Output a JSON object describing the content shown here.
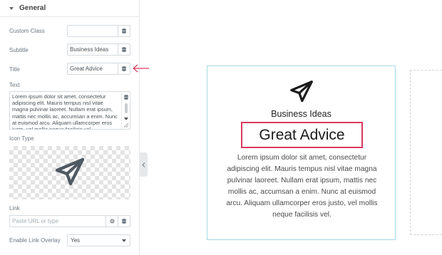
{
  "panel": {
    "section_title": "General",
    "fields": {
      "custom_class": {
        "label": "Custom Class",
        "value": ""
      },
      "subtitle": {
        "label": "Subtitle",
        "value": "Business Ideas"
      },
      "title": {
        "label": "Title",
        "value": "Great Advice"
      },
      "text": {
        "label": "Text",
        "value": "Lorem ipsum dolor sit amet, consectetur adipiscing elit. Mauris tempus nisl vitae magna pulvinar laoreet. Nullam erat ipsum, mattis nec mollis ac, accumsan a enim. Nunc at euismod arcu. Aliquam ullamcorper eros justo, vel mollis neque facilisis vel."
      },
      "icon_type": {
        "label": "Icon Type",
        "icon": "paper-plane-icon"
      },
      "link": {
        "label": "Link",
        "placeholder": "Paste URL or type"
      },
      "enable_link_overlay": {
        "label": "Enable Link Overlay",
        "value": "Yes"
      }
    }
  },
  "preview": {
    "icon": "paper-plane-icon",
    "subtitle": "Business Ideas",
    "title": "Great Advice",
    "text": "Lorem ipsum dolor sit amet, consectetur adipiscing elit. Mauris tempus nisl vitae magna pulvinar laoreet. Nullam erat ipsum, mattis nec mollis ac, accumsan a enim. Nunc at euismod arcu. Aliquam ullamcorper eros justo, vel mollis neque facilisis vel."
  },
  "colors": {
    "annotation": "#d83a5f",
    "card_border": "#a7d9e8"
  }
}
